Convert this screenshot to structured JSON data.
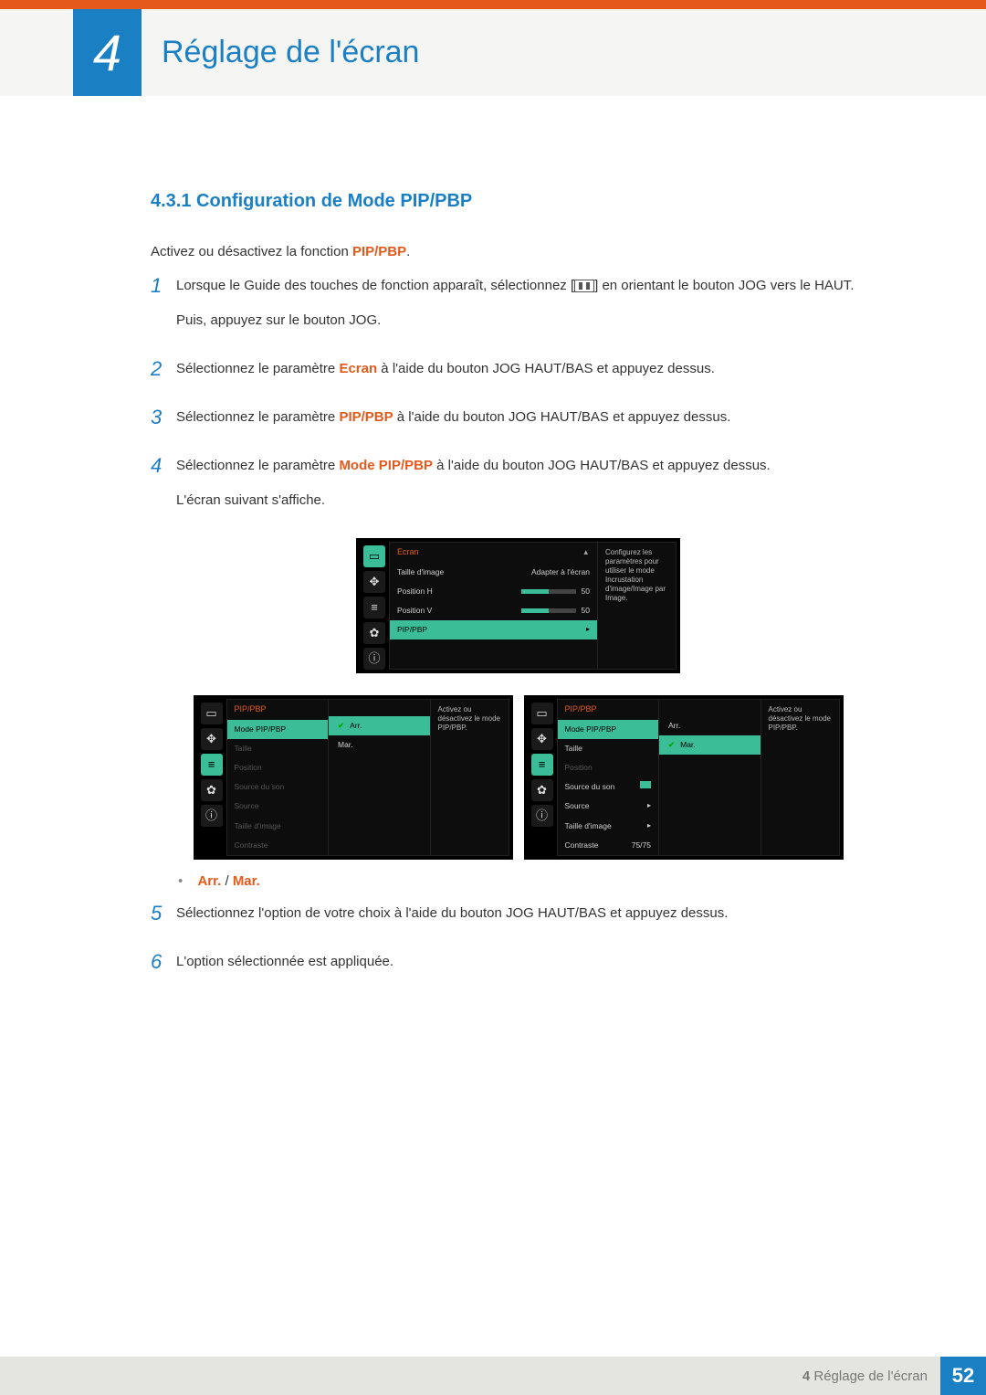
{
  "header": {
    "chapter_number": "4",
    "chapter_title": "Réglage de l'écran"
  },
  "section": {
    "number": "4.3.1",
    "title": "Configuration de Mode PIP/PBP"
  },
  "intro": {
    "prefix": "Activez ou désactivez la fonction ",
    "highlight": "PIP/PBP",
    "suffix": "."
  },
  "steps": {
    "s1_a": "Lorsque le Guide des touches de fonction apparaît, sélectionnez [",
    "s1_b": "] en orientant le bouton JOG vers le HAUT.",
    "s1_c": "Puis, appuyez sur le bouton JOG.",
    "s2_a": "Sélectionnez le paramètre ",
    "s2_hl": "Ecran",
    "s2_b": " à l'aide du bouton JOG HAUT/BAS et appuyez dessus.",
    "s3_a": "Sélectionnez le paramètre ",
    "s3_hl": "PIP/PBP",
    "s3_b": " à l'aide du bouton JOG HAUT/BAS et appuyez dessus.",
    "s4_a": "Sélectionnez le paramètre ",
    "s4_hl": "Mode PIP/PBP",
    "s4_b": " à l'aide du bouton JOG HAUT/BAS et appuyez dessus.",
    "s4_c": "L'écran suivant s'affiche.",
    "s5": "Sélectionnez l'option de votre choix à l'aide du bouton JOG HAUT/BAS et appuyez dessus.",
    "s6": "L'option sélectionnée est appliquée."
  },
  "osd1": {
    "head": "Ecran",
    "rows": [
      {
        "label": "Taille d'image",
        "value": "Adapter à l'écran"
      },
      {
        "label": "Position H",
        "value": "50"
      },
      {
        "label": "Position V",
        "value": "50"
      },
      {
        "label": "PIP/PBP",
        "value": "▸"
      }
    ],
    "hint": "Configurez les paramètres pour utiliser le mode Incrustation d'image/Image par Image."
  },
  "osd2": {
    "head": "PIP/PBP",
    "rows": [
      {
        "label": "Mode PIP/PBP",
        "sel": true
      },
      {
        "label": "Taille",
        "dim": true
      },
      {
        "label": "Position",
        "dim": true
      },
      {
        "label": "Source du son",
        "dim": true
      },
      {
        "label": "Source",
        "dim": true
      },
      {
        "label": "Taille d'image",
        "dim": true
      },
      {
        "label": "Contraste",
        "dim": true
      }
    ],
    "opts": [
      {
        "label": "Arr.",
        "sel": true,
        "check": true
      },
      {
        "label": "Mar."
      }
    ],
    "hint": "Activez ou désactivez le mode PIP/PBP."
  },
  "osd3": {
    "head": "PIP/PBP",
    "rows": [
      {
        "label": "Mode PIP/PBP",
        "sel": true
      },
      {
        "label": "Taille"
      },
      {
        "label": "Position",
        "dim": true
      },
      {
        "label": "Source du son",
        "rv": "box"
      },
      {
        "label": "Source",
        "rv": "▸"
      },
      {
        "label": "Taille d'image",
        "rv": "▸"
      },
      {
        "label": "Contraste",
        "rv": "75/75"
      }
    ],
    "opts": [
      {
        "label": "Arr."
      },
      {
        "label": "Mar.",
        "sel": true,
        "check": true
      }
    ],
    "hint": "Activez ou désactivez le mode PIP/PBP."
  },
  "bullet": {
    "arr": "Arr.",
    "sep": " / ",
    "mar": "Mar."
  },
  "footer": {
    "label_prefix": "4 ",
    "label": "Réglage de l'écran",
    "page": "52"
  }
}
